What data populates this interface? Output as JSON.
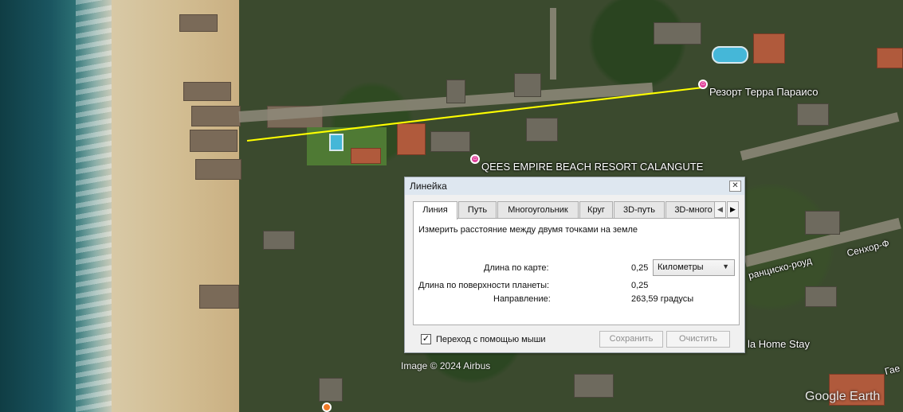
{
  "map": {
    "places": [
      {
        "name": "Резорт Терра Параисо"
      },
      {
        "name": "QEES EMPIRE BEACH RESORT CALANGUTE"
      },
      {
        "name": "la Home Stay"
      }
    ],
    "roads": [
      {
        "name": "Сенхор-Ф"
      },
      {
        "name": "ранциско-роуд"
      },
      {
        "name": "Гае"
      }
    ],
    "copyright": "Image © 2024 Airbus",
    "brand": "Google Earth",
    "measure_line_color": "#ffff00"
  },
  "ruler": {
    "title": "Линейка",
    "close_icon": "close-icon",
    "tabs": [
      {
        "label": "Линия",
        "active": true
      },
      {
        "label": "Путь",
        "active": false
      },
      {
        "label": "Многоугольник",
        "active": false
      },
      {
        "label": "Круг",
        "active": false
      },
      {
        "label": "3D-путь",
        "active": false
      },
      {
        "label": "3D-много",
        "active": false
      }
    ],
    "description": "Измерить расстояние между двумя точками на земле",
    "map_length_label": "Длина по карте:",
    "map_length_value": "0,25",
    "unit": "Километры",
    "ground_length_label": "Длина по поверхности планеты:",
    "ground_length_value": "0,25",
    "heading_label": "Направление:",
    "heading_value": "263,59 градусы",
    "mouse_nav_label": "Переход с помощью мыши",
    "mouse_nav_checked": true,
    "save_label": "Сохранить",
    "clear_label": "Очистить"
  }
}
